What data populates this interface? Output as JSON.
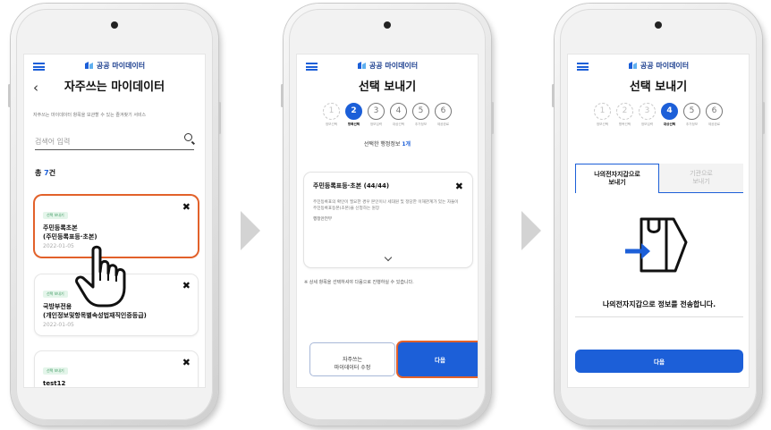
{
  "logo_text": "공공 마이데이터",
  "screen1": {
    "title": "자주쓰는 마이데이터",
    "description": "자주쓰는 마이데이터 항목을 보관할 수 있는 즐겨찾기 서비스",
    "search_placeholder": "검색어 입력",
    "total_prefix": "총 ",
    "total_count": "7",
    "total_suffix": "건",
    "cards": [
      {
        "tag": "선택 보내기",
        "title_line1": "주민등록초본",
        "title_line2": "(주민등록표등·초본)",
        "date": "2022-01-05"
      },
      {
        "tag": "선택 보내기",
        "title_line1": "국방부전용",
        "title_line2": "(개인정보및항목별속성법재직인증등급)",
        "date": "2022-01-05"
      },
      {
        "tag": "선택 보내기",
        "title_line1": "test12",
        "title_line2": "",
        "date": ""
      }
    ],
    "close_glyph": "✖"
  },
  "screen2": {
    "title": "선택 보내기",
    "steps": [
      "1",
      "2",
      "3",
      "4",
      "5",
      "6"
    ],
    "step_labels": [
      "정보선택",
      "항목선택",
      "정보입력",
      "대상선택",
      "추가정보",
      "제공완료"
    ],
    "selected_prefix": "선택한 행정정보 ",
    "selected_count": "1개",
    "detail_title": "주민등록표등·초본 (44/44)",
    "detail_desc": "주민등록표의 확인이 필요한 경우 본인이나 세대원 및 정당한 이해관계가 있는 자들이 주민등록표등본(초본)을 신청하는 원장",
    "detail_org": "행정안전부",
    "note": "※ 상세 항목을 선택하셔야 다음으로 진행하실 수 있습니다.",
    "button_edit_line1": "자주쓰는",
    "button_edit_line2": "마이데이터 수정",
    "button_next": "다음"
  },
  "screen3": {
    "title": "선택 보내기",
    "steps": [
      "1",
      "2",
      "3",
      "4",
      "5",
      "6"
    ],
    "step_labels": [
      "정보선택",
      "항목선택",
      "정보입력",
      "대상선택",
      "추가정보",
      "제공완료"
    ],
    "tab_active_line1": "나의전자지갑으로",
    "tab_active_line2": "보내기",
    "tab_inactive_line1": "기관으로",
    "tab_inactive_line2": "보내기",
    "message": "나의전자지갑으로 정보를 전송합니다.",
    "button_next": "다음"
  },
  "colors": {
    "primary": "#1c5fd8",
    "highlight": "#e2612a",
    "tag_green": "#3f9a62"
  }
}
